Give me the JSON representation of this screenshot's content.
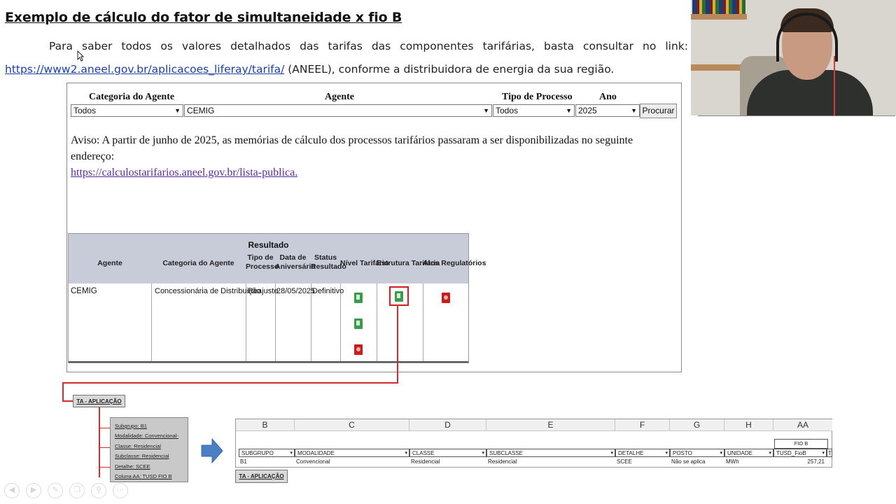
{
  "slide": {
    "title": "Exemplo de cálculo do fator de simultaneidade x fio B",
    "para_words": [
      "Para",
      "saber",
      "todos",
      "os",
      "valores",
      "detalhados",
      "das",
      "tarifas",
      "das",
      "componentes",
      "tarifárias,",
      "basta",
      "consultar",
      "no",
      "link:"
    ],
    "link": "https://www2.aneel.gov.br/aplicacoes_liferay/tarifa/",
    "para_tail": " (ANEEL), conforme a distribuidora de energia da sua região."
  },
  "form": {
    "categoria_label": "Categoria do Agente",
    "categoria_value": "Todos",
    "agente_label": "Agente",
    "agente_value": "CEMIG",
    "tipo_label": "Tipo de Processo",
    "tipo_value": "Todos",
    "ano_label": "Ano",
    "ano_value": "2025",
    "procurar": "Procurar"
  },
  "notice": {
    "text": "Aviso: A partir de junho de 2025, as memórias de cálculo dos processos tarifários passaram a ser disponibilizadas no seguinte endereço:",
    "link": "https://calculostarifarios.aneel.gov.br/lista-publica."
  },
  "results": {
    "title": "Resultado",
    "columns": {
      "agente": "Agente",
      "categoria": "Categoria do Agente",
      "tipo_a": "Tipo de",
      "tipo_b": "Processo",
      "data_a": "Data de",
      "data_b": "Aniversário",
      "status_a": "Status",
      "status_b": "Resultado",
      "nivel": "Nível Tarifário",
      "estrutura": "Estrutura Tarifária",
      "atos": "Atos Regulatórios"
    },
    "row": {
      "agente": "CEMIG",
      "categoria": "Concessionária de Distribuição",
      "tipo": "Reajuste",
      "data": "28/05/2025",
      "status": "Definitivo"
    }
  },
  "annotations": {
    "tag_top": "TA - APLICAÇÃO",
    "details": [
      "Subgrupo: B1",
      "Modalidade: Convencional-",
      "Classe: Residencial",
      "Subclasse: Residencial",
      "Detalhe: SCEE",
      "Coluna AA: TUSD FIO B"
    ],
    "tag_bottom": "TA - APLICAÇÃO"
  },
  "sheet": {
    "col_letters": [
      "B",
      "C",
      "D",
      "E",
      "F",
      "G",
      "H",
      "AA"
    ],
    "group_header": "FIO B",
    "headers": [
      "SUBGRUPO",
      "MODALIDADE",
      "CLASSE",
      "SUBCLASSE",
      "DETALHE",
      "POSTO",
      "UNIDADE",
      "TUSD_FioB"
    ],
    "values": [
      "B1",
      "Convencional",
      "Residencial",
      "Residencial",
      "SCEE",
      "Não se aplica",
      "MWh",
      "257,21"
    ],
    "extra_col": "T"
  },
  "colors": {
    "link": "#1b3fa6",
    "notice_link": "#5a2aa0",
    "highlight": "#cc1f1f",
    "result_header": "#c8ccd9",
    "arrow": "#4a7fc4"
  },
  "icons": [
    "cursor-icon",
    "spreadsheet-icon",
    "pdf-icon",
    "right-arrow-icon",
    "prev-icon",
    "next-icon",
    "pen-icon",
    "copy-icon",
    "zoom-icon",
    "more-icon"
  ]
}
